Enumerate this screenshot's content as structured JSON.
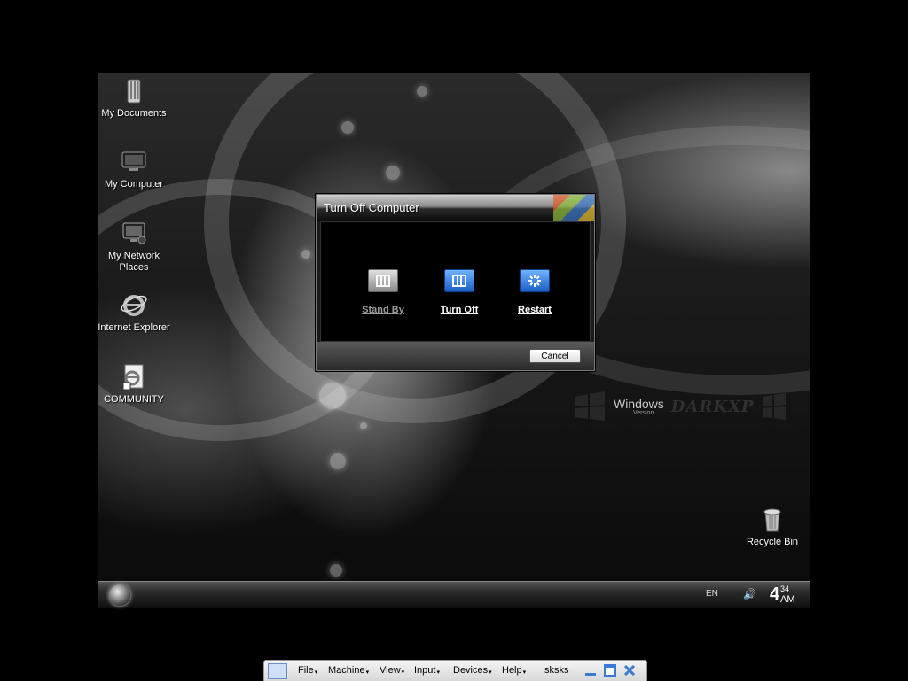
{
  "desktop": {
    "icons": [
      {
        "label": "My Documents",
        "icon": "folder-documents-icon"
      },
      {
        "label": "My Computer",
        "icon": "computer-monitor-icon"
      },
      {
        "label": "My Network Places",
        "icon": "network-places-icon"
      },
      {
        "label": "Internet Explorer",
        "icon": "internet-explorer-icon"
      },
      {
        "label": "COMMUNITY",
        "icon": "community-shortcut-icon"
      },
      {
        "label": "Recycle Bin",
        "icon": "recycle-bin-icon"
      }
    ],
    "brand": {
      "name": "Windows",
      "sub": "Version",
      "graffiti": "DARKXP"
    }
  },
  "dialog": {
    "title": "Turn Off Computer",
    "options": [
      {
        "label": "Stand By",
        "icon": "stand-by-icon",
        "color": "#9a9a9a"
      },
      {
        "label": "Turn Off",
        "icon": "turn-off-icon",
        "color": "#2a7de1"
      },
      {
        "label": "Restart",
        "icon": "restart-icon",
        "color": "#2a7de1"
      }
    ],
    "cancel_label": "Cancel"
  },
  "taskbar": {
    "language": "EN",
    "clock": {
      "hour": "4",
      "minutes": "34",
      "ampm": "AM"
    }
  },
  "vbox_bar": {
    "menus": [
      "File",
      "Machine",
      "View",
      "Input",
      "Devices",
      "Help"
    ],
    "vm_name": "sksks"
  }
}
